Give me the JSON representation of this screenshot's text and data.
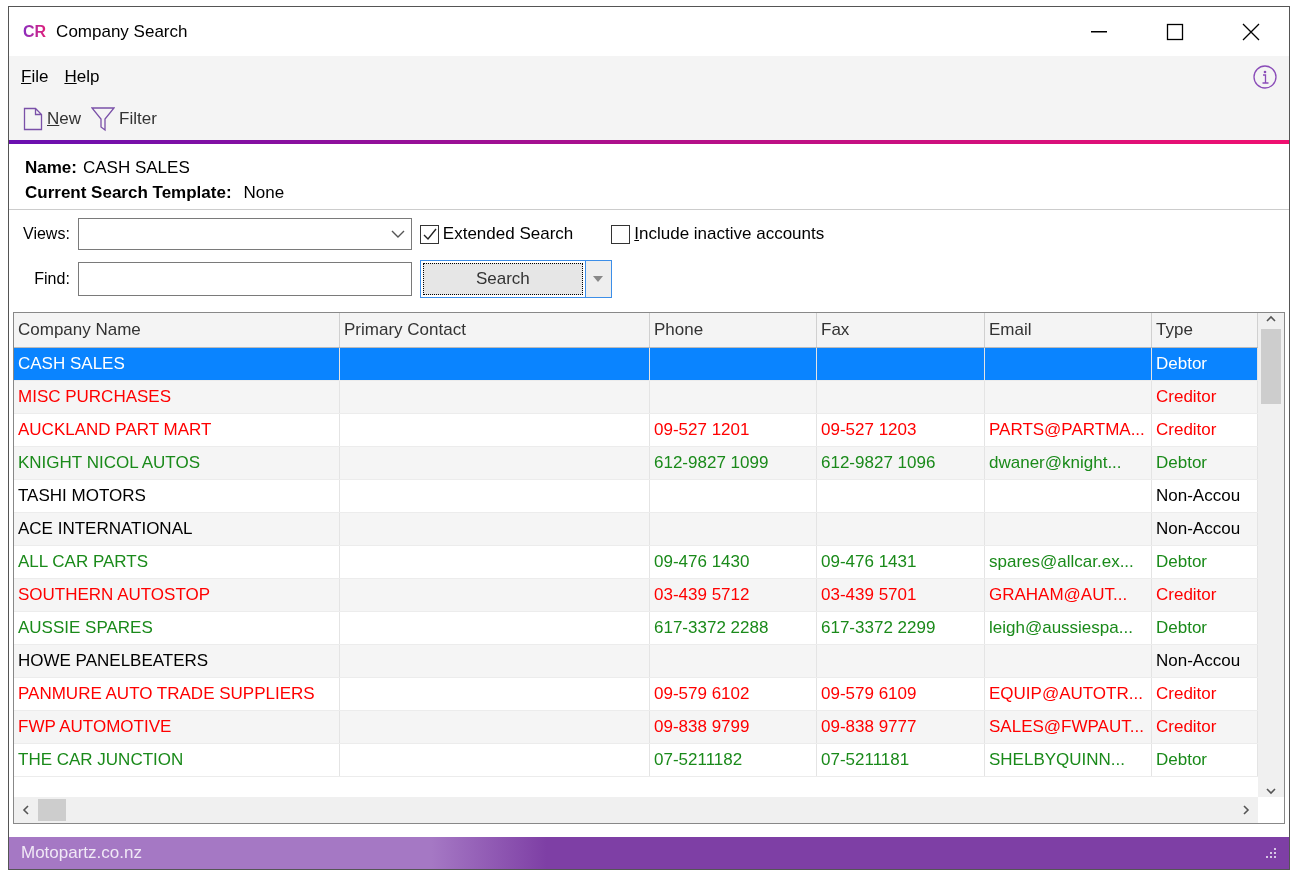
{
  "window": {
    "logo": "CR",
    "title": "Company Search"
  },
  "menu": [
    {
      "label": "File"
    },
    {
      "label": "Help"
    }
  ],
  "toolbar": [
    {
      "label": "New",
      "kind": "new"
    },
    {
      "label": "Filter",
      "kind": "filter"
    }
  ],
  "info": {
    "name_label": "Name:",
    "name_value": "CASH SALES",
    "template_label": "Current Search Template:",
    "template_value": "None"
  },
  "views": {
    "label": "Views:"
  },
  "checkboxes": [
    {
      "label": "Extended Search",
      "checked": true
    },
    {
      "label": "Include inactive accounts",
      "checked": false
    }
  ],
  "find": {
    "label": "Find:"
  },
  "search_button": {
    "label": "Search"
  },
  "table": {
    "columns": [
      "Company Name",
      "Primary Contact",
      "Phone",
      "Fax",
      "Email",
      "Type"
    ],
    "rows": [
      {
        "selected": true,
        "cells": [
          "CASH SALES",
          "",
          "",
          "",
          "",
          "Debtor"
        ]
      },
      {
        "selected": false,
        "color": "#ff0000",
        "cells": [
          "MISC PURCHASES",
          "",
          "",
          "",
          "",
          "Creditor"
        ]
      },
      {
        "selected": false,
        "color": "#ff0000",
        "cells": [
          "AUCKLAND PART MART",
          "",
          "09-527 1201",
          "09-527 1203",
          "PARTS@PARTMA...",
          "Creditor"
        ]
      },
      {
        "selected": false,
        "color": "#1a8a1a",
        "cells": [
          "KNIGHT NICOL AUTOS",
          "",
          "612-9827 1099",
          "612-9827 1096",
          "dwaner@knight...",
          "Debtor"
        ]
      },
      {
        "selected": false,
        "color": "#000000",
        "cells": [
          "TASHI MOTORS",
          "",
          "",
          "",
          "",
          "Non-Accou"
        ]
      },
      {
        "selected": false,
        "color": "#000000",
        "cells": [
          "ACE INTERNATIONAL",
          "",
          "",
          "",
          "",
          "Non-Accou"
        ]
      },
      {
        "selected": false,
        "color": "#1a8a1a",
        "cells": [
          "ALL CAR PARTS",
          "",
          "09-476 1430",
          "09-476 1431",
          "spares@allcar.ex...",
          "Debtor"
        ]
      },
      {
        "selected": false,
        "color": "#ff0000",
        "cells": [
          "SOUTHERN AUTOSTOP",
          "",
          "03-439 5712",
          "03-439 5701",
          "GRAHAM@AUT...",
          "Creditor"
        ]
      },
      {
        "selected": false,
        "color": "#1a8a1a",
        "cells": [
          "AUSSIE SPARES",
          "",
          "617-3372 2288",
          "617-3372 2299",
          "leigh@aussiespa...",
          "Debtor"
        ]
      },
      {
        "selected": false,
        "color": "#000000",
        "cells": [
          "HOWE PANELBEATERS",
          "",
          "",
          "",
          "",
          "Non-Accou"
        ]
      },
      {
        "selected": false,
        "color": "#ff0000",
        "cells": [
          "PANMURE AUTO TRADE SUPPLIERS",
          "",
          "09-579 6102",
          "09-579 6109",
          "EQUIP@AUTOTR...",
          "Creditor"
        ]
      },
      {
        "selected": false,
        "color": "#ff0000",
        "cells": [
          "FWP AUTOMOTIVE",
          "",
          "09-838 9799",
          "09-838 9777",
          "SALES@FWPAUT...",
          "Creditor"
        ]
      },
      {
        "selected": false,
        "color": "#1a8a1a",
        "cells": [
          "THE CAR JUNCTION",
          "",
          "07-5211182",
          "07-5211181",
          "SHELBYQUINN...",
          "Debtor"
        ]
      }
    ]
  },
  "status_bar": {
    "text": "Motopartz.co.nz"
  }
}
